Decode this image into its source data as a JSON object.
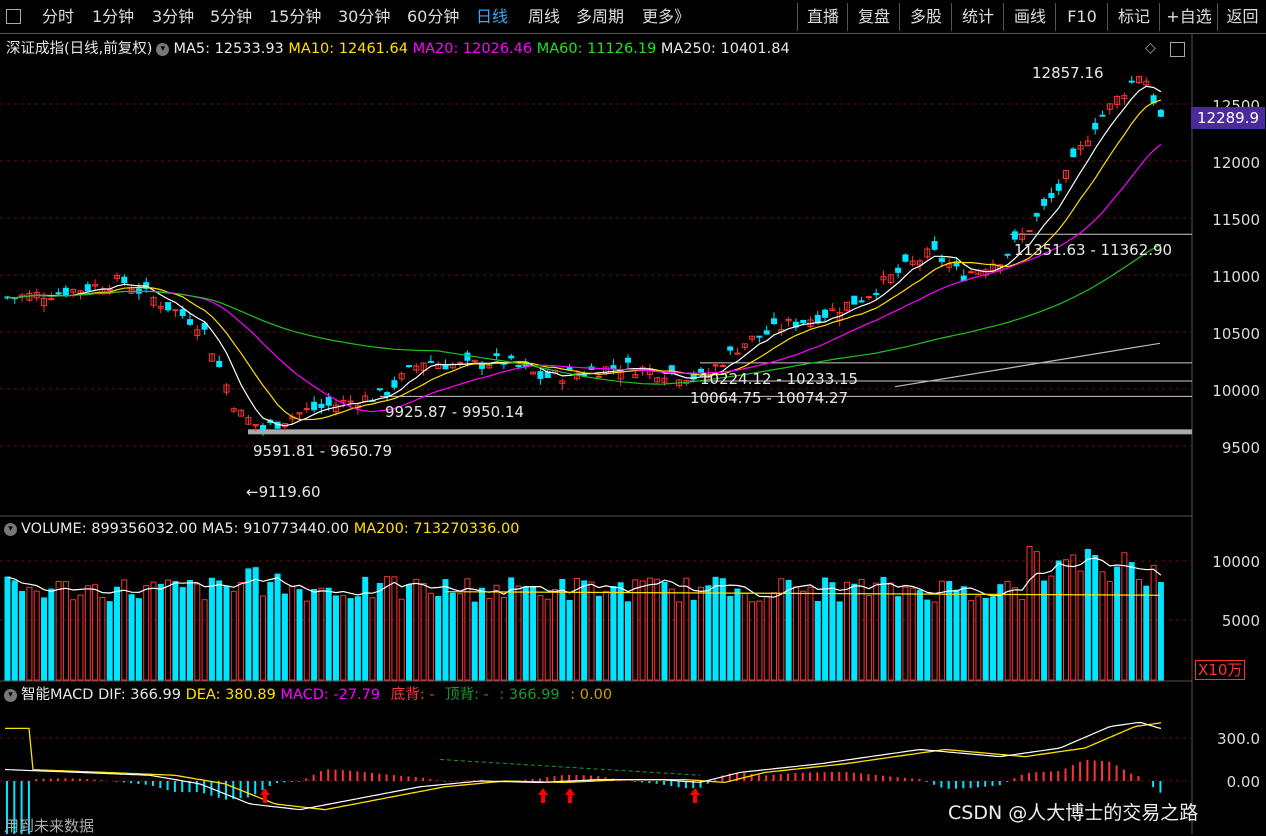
{
  "toolbar": {
    "left_items": [
      "分时",
      "1分钟",
      "3分钟",
      "5分钟",
      "15分钟",
      "30分钟",
      "60分钟",
      "日线",
      "周线",
      "多周期",
      "更多》"
    ],
    "active_index": 7,
    "right_items": [
      "直播",
      "复盘",
      "多股",
      "统计",
      "画线",
      "F10",
      "标记",
      "+自选",
      "返回"
    ]
  },
  "main_header": {
    "title": "深证成指(日线,前复权)",
    "ma5": "MA5: 12533.93",
    "ma10": "MA10: 12461.64",
    "ma20": "MA20: 12026.46",
    "ma60": "MA60: 11126.19",
    "ma250": "MA250: 10401.84"
  },
  "price_axis": [
    "12500",
    "12000",
    "11500",
    "11000",
    "10500",
    "10000",
    "9500"
  ],
  "last_price": "12289.9",
  "annotations": {
    "high": "12857.16",
    "low": "←9119.60",
    "zone1": "9591.81 - 9650.79",
    "zone2": "9925.87 - 9950.14",
    "zone3": "10224.12 - 10233.15",
    "zone4": "10064.75 - 10074.27",
    "zone5": "11351.63 - 11362.90"
  },
  "volume_header": {
    "volume": "VOLUME: 899356032.00",
    "ma5": "MA5: 910773440.00",
    "ma200": "MA200: 713270336.00"
  },
  "volume_axis": [
    "10000",
    "5000"
  ],
  "volume_unit": "X10万",
  "macd_header": {
    "title": "智能MACD",
    "dif": "DIF: 366.99",
    "dea": "DEA: 380.89",
    "macd": "MACD: -27.79",
    "bottom_div": "底背: -",
    "top_div": "顶背: -",
    "val1": ": 366.99",
    "val2": ": 0.00"
  },
  "macd_axis": [
    "300.0",
    "0.00"
  ],
  "footer_note": "用到未来数据",
  "watermark": "CSDN @人大博士的交易之路",
  "colors": {
    "up": "#ff3333",
    "down": "#00e5ff",
    "ma5": "#ffffff",
    "ma10": "#ffe000",
    "ma20": "#ff00ff",
    "ma60": "#20c020",
    "ma250": "#bbbbbb",
    "accent": "#33aaff"
  }
}
